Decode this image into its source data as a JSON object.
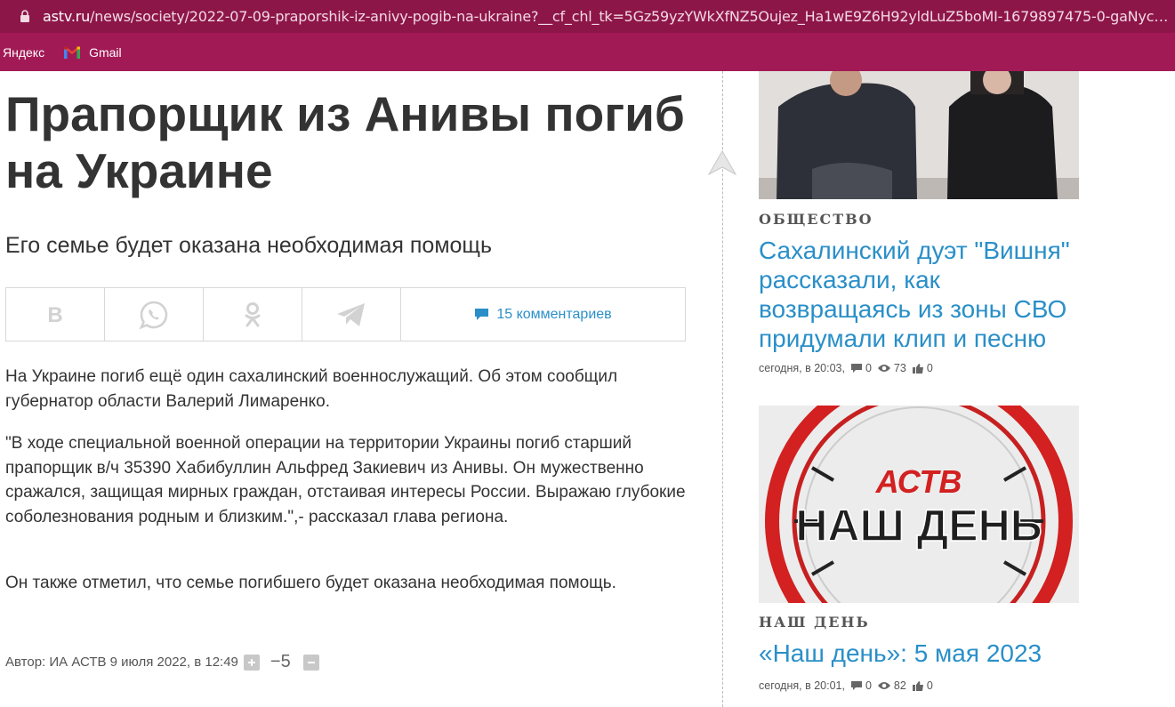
{
  "browser": {
    "url_host": "astv.ru",
    "url_path": "/news/society/2022-07-09-praporshik-iz-anivy-pogib-na-ukraine?__cf_chl_tk=5Gz59yzYWkXfNZ5Oujez_Ha1wE9Z6H92yldLuZ5boMI-1679897475-0-gaNycGz...",
    "bookmarks": [
      {
        "label": "Яндекс",
        "icon": "none"
      },
      {
        "label": "Gmail",
        "icon": "gmail-icon"
      }
    ],
    "colors": {
      "chrome": "#a21a55",
      "address_bar": "#8d1649"
    }
  },
  "article": {
    "title": "Прапорщик из Анивы погиб на Украине",
    "subtitle": "Его семье будет оказана необходимая помощь",
    "share": {
      "buttons": [
        "vk-icon",
        "whatsapp-icon",
        "odnoklassniki-icon",
        "telegram-icon"
      ],
      "comments_label": "15 комментариев"
    },
    "paragraphs": [
      "На Украине погиб ещё один сахалинский военнослужащий. Об этом сообщил губернатор области Валерий Лимаренко.",
      "\"В ходе специальной военной операции на территории Украины погиб старший прапорщик в/ч 35390 Хабибуллин Альфред Закиевич из Анивы. Он мужественно сражался, защищая мирных граждан, отстаивая интересы России. Выражаю глубокие соболезнования родным и близким.\",- рассказал глава региона.",
      "Он также отметил, что семье погибшего будет оказана необходимая помощь."
    ],
    "author_line": "Автор: ИА АСТВ 9 июля 2022, в 12:49",
    "rating": "−5"
  },
  "sidebar": {
    "items": [
      {
        "category": "ОБЩЕСТВО",
        "title": "Сахалинский дуэт \"Вишня\" рассказали, как возвращаясь из зоны СВО придумали клип и песню",
        "time": "сегодня, в 20:03,",
        "comments": "0",
        "views": "73",
        "likes": "0"
      },
      {
        "category": "НАШ ДЕНЬ",
        "title": "«Наш день»: 5 мая 2023",
        "time": "сегодня, в 20:01,",
        "comments": "0",
        "views": "82",
        "likes": "0",
        "image_logo": "АСТВ",
        "image_text": "НАШ ДЕНЬ"
      }
    ]
  },
  "colors": {
    "link": "#2a8fc8",
    "text": "#333333"
  }
}
